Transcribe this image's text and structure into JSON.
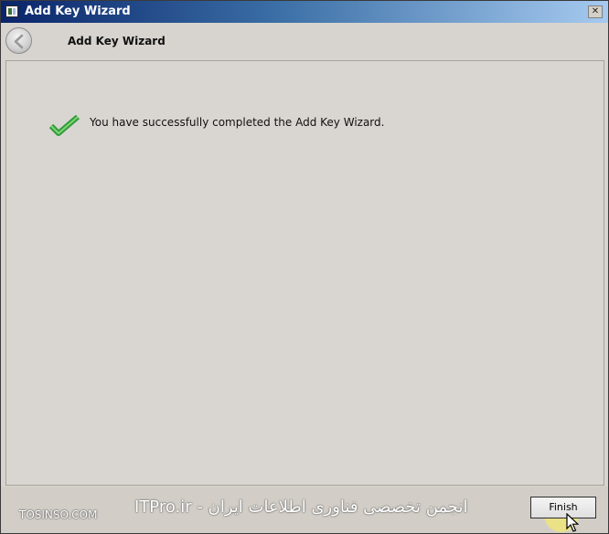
{
  "window": {
    "title": "Add Key Wizard"
  },
  "header": {
    "title": "Add Key Wizard",
    "back_icon": "back-arrow-icon"
  },
  "main": {
    "message": "You have successfully completed the Add Key Wizard.",
    "status_icon": "check-icon",
    "status_color": "#38b44a"
  },
  "footer": {
    "watermark_site": "TOSINSO.COM",
    "watermark_text": "ITPro.ir - انجمن تخصصی فناوری اطلاعات ایران",
    "finish_label": "Finish"
  },
  "colors": {
    "titlebar_start": "#0a246a",
    "titlebar_end": "#a6caf0",
    "window_bg": "#d7d4cf"
  }
}
